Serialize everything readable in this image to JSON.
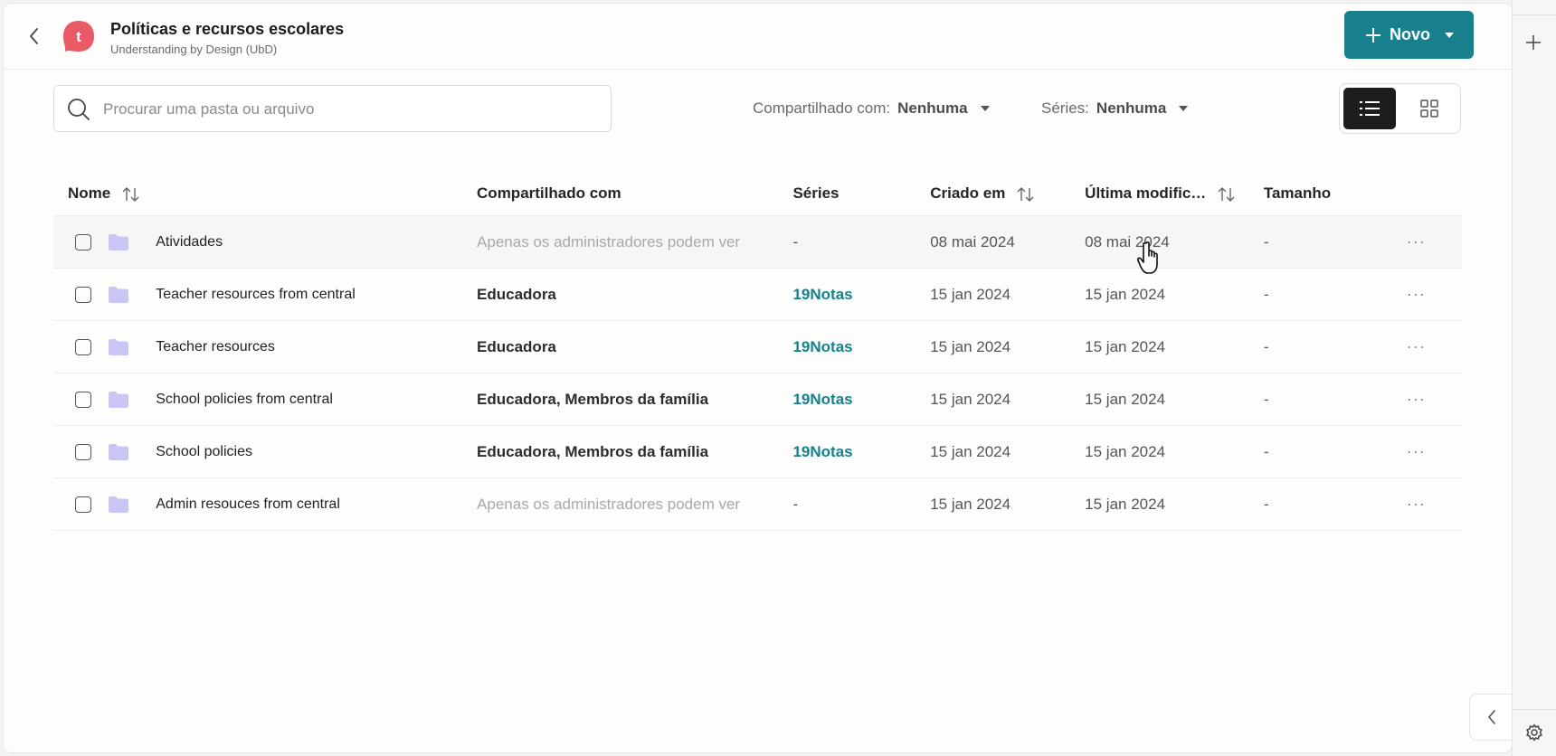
{
  "header": {
    "logo_letter": "t",
    "title": "Políticas e recursos escolares",
    "subtitle": "Understanding by Design (UbD)",
    "new_button": "Novo"
  },
  "toolbar": {
    "search_placeholder": "Procurar uma pasta ou arquivo",
    "shared_filter_label": "Compartilhado com:",
    "shared_filter_value": "Nenhuma",
    "series_filter_label": "Séries:",
    "series_filter_value": "Nenhuma",
    "view_mode": "list"
  },
  "table": {
    "columns": {
      "name": "Nome",
      "shared": "Compartilhado com",
      "series": "Séries",
      "created": "Criado em",
      "modified": "Última modific…",
      "size": "Tamanho"
    },
    "rows": [
      {
        "name": "Atividades",
        "shared": "Apenas os administradores podem ver",
        "series": "-",
        "created": "08 mai 2024",
        "modified": "08 mai 2024",
        "size": "-"
      },
      {
        "name": "Teacher resources from central",
        "shared": "Educadora",
        "series": "19Notas",
        "created": "15 jan 2024",
        "modified": "15 jan 2024",
        "size": "-"
      },
      {
        "name": "Teacher resources",
        "shared": "Educadora",
        "series": "19Notas",
        "created": "15 jan 2024",
        "modified": "15 jan 2024",
        "size": "-"
      },
      {
        "name": "School policies from central",
        "shared": "Educadora, Membros da família",
        "series": "19Notas",
        "created": "15 jan 2024",
        "modified": "15 jan 2024",
        "size": "-"
      },
      {
        "name": "School policies",
        "shared": "Educadora, Membros da família",
        "series": "19Notas",
        "created": "15 jan 2024",
        "modified": "15 jan 2024",
        "size": "-"
      },
      {
        "name": "Admin resouces from central",
        "shared": "Apenas os administradores podem ver",
        "series": "-",
        "created": "15 jan 2024",
        "modified": "15 jan 2024",
        "size": "-"
      }
    ],
    "more_glyph": "···"
  },
  "colors": {
    "accent": "#17808c",
    "logo": "#e85a66",
    "folder": "#c9c6f5"
  }
}
